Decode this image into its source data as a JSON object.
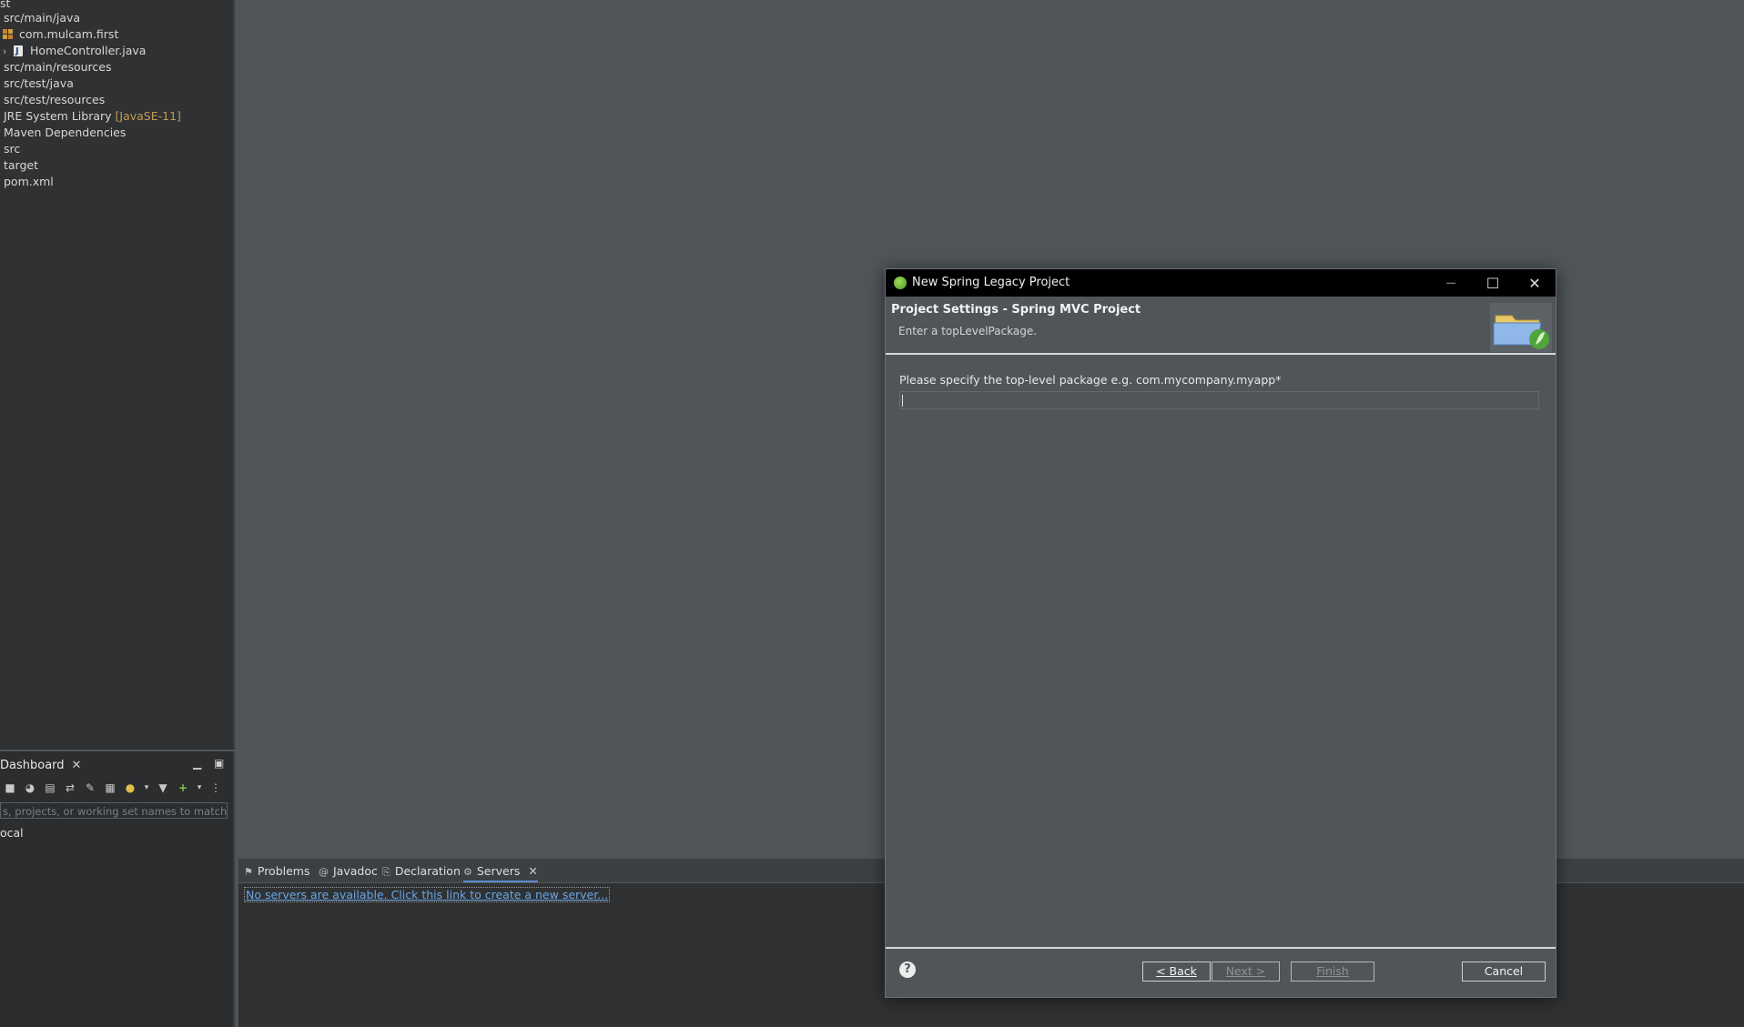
{
  "explorer": {
    "items": [
      {
        "label": "st",
        "indent": "none"
      },
      {
        "label": "src/main/java"
      },
      {
        "label": "com.mulcam.first"
      },
      {
        "label": "HomeController.java"
      },
      {
        "label": "src/main/resources"
      },
      {
        "label": "src/test/java"
      },
      {
        "label": "src/test/resources"
      },
      {
        "label": "JRE System Library",
        "decoration": "[JavaSE-11]"
      },
      {
        "label": "Maven Dependencies"
      },
      {
        "label": "src"
      },
      {
        "label": "target"
      },
      {
        "label": "pom.xml"
      }
    ]
  },
  "dashboard": {
    "tab_label": "Dashboard",
    "close_glyph": "✕",
    "filter_placeholder": "s, projects, or working set names to match (in",
    "local_label": "ocal"
  },
  "bottom_panel": {
    "tabs": [
      {
        "label": "Problems",
        "icon": "problems-icon"
      },
      {
        "label": "Javadoc",
        "icon": "javadoc-icon"
      },
      {
        "label": "Declaration",
        "icon": "declaration-icon"
      },
      {
        "label": "Servers",
        "icon": "servers-icon",
        "active": true
      }
    ],
    "servers_link": "No servers are available. Click this link to create a new server..."
  },
  "dialog": {
    "title": "New Spring Legacy Project",
    "header_title": "Project Settings - Spring MVC Project",
    "header_subtitle": "Enter a  topLevelPackage.",
    "field_label": "Please specify the top-level package e.g. com.mycompany.myapp*",
    "field_value": "",
    "buttons": {
      "back": "< Back",
      "next": "Next >",
      "finish": "Finish",
      "cancel": "Cancel"
    },
    "help_glyph": "?"
  },
  "colors": {
    "accent_link": "#6aa6e6",
    "dialog_bg": "#4f5559",
    "titlebar": "#000000"
  }
}
